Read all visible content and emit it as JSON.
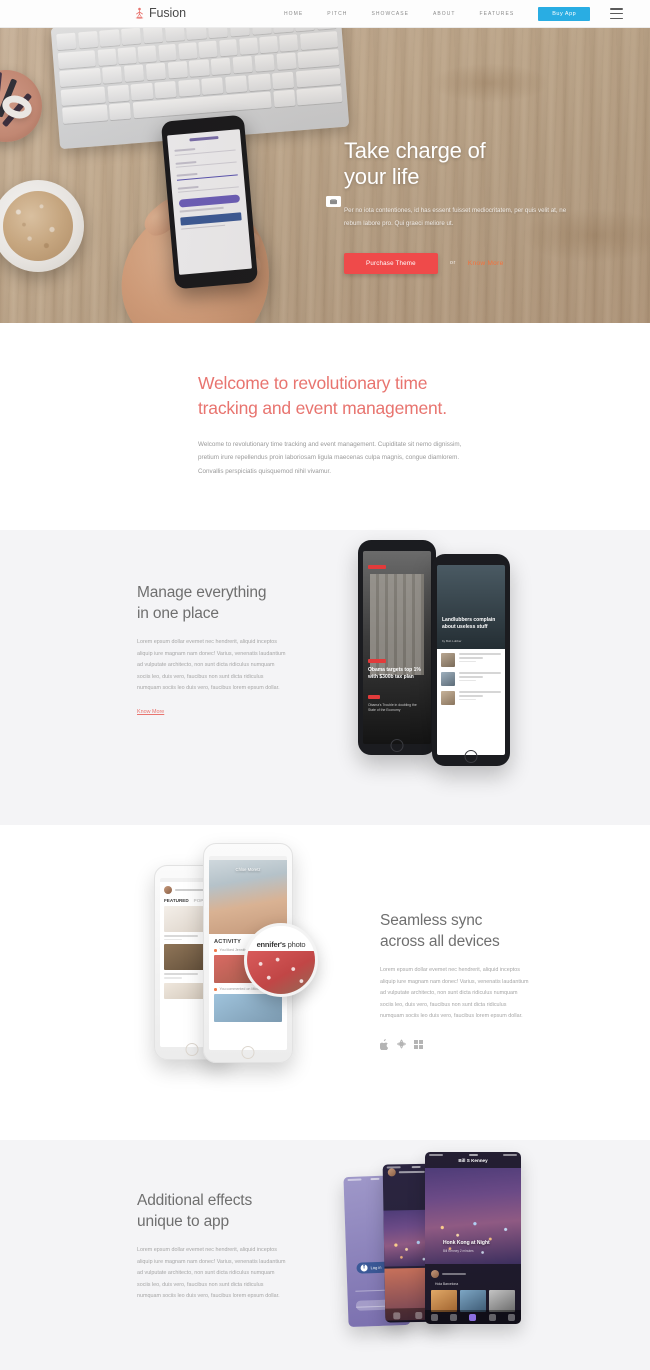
{
  "header": {
    "logo_text": "Fusion",
    "logo_icon": "fusion-figure-icon",
    "nav_items": [
      {
        "label": "HOME"
      },
      {
        "label": "PITCH"
      },
      {
        "label": "SHOWCASE"
      },
      {
        "label": "ABOUT"
      },
      {
        "label": "FEATURES"
      }
    ],
    "buy_label": "Buy App",
    "menu_icon": "hamburger-menu-icon",
    "accent_blue": "#29ade3"
  },
  "hero": {
    "title_line1": "Take charge of",
    "title_line2": "your life",
    "subtitle": "Per no iota contentiones, id has essent fuisset mediocritatem, per quis velit at, ne rebum labore pro. Qui graeci meliore ut.",
    "primary_button": "Purchase Theme",
    "or_text": "or",
    "secondary_link": "Know More",
    "primary_color": "#ef4a4a",
    "link_color": "#f4713c",
    "badge_icon": "play-badge-icon"
  },
  "welcome": {
    "title": "Welcome to revolutionary time tracking and event management.",
    "body": "Welcome to revolutionary time tracking and event management. Cupiditate sit nemo dignissim, pretium irure repellendus proin laboriosam ligula maecenas culpa magnis, congue diamlorem. Convallis perspiciatis quisquemod nihil vivamur.",
    "title_color": "#e8746f"
  },
  "sections": [
    {
      "id": "manage",
      "title_line1": "Manage everything",
      "title_line2": "in one place",
      "body": "Lorem epsum dollar evemet nec hendrerit, aliquid inceptos aliquip iure magnam nam donec! Varius, venenatis laudantium ad vulputate architecto, non sunt dicta ridiculus numquam sociis leo, duis vero, faucibus non sunt dicta ridiculus numquam sociis leo duis vero, faucibus lorem epsum dollar.",
      "link": "Know More",
      "background": "#f4f4f6",
      "media": {
        "type": "news-app-phones",
        "phone_a": {
          "tag": "WATCH LIVE",
          "headline": "Obama targets top 1% with $300b tax plan",
          "sub_tag": "RELATED",
          "sub_headline": "Obama's Trouble in doubling the State of the Economy"
        },
        "phone_b": {
          "headline": "Landlubbers complain about useless stuff",
          "byline": "by Bob Lubber",
          "list": [
            "Croatian parrot charged with flying while under influence",
            "Search for the fountain of Youth while on holiday!",
            "Install these 10 mistakes while exporin' the arctic waters"
          ]
        }
      }
    },
    {
      "id": "seamless",
      "title_line1": "Seamless sync",
      "title_line2": "across all devices",
      "body": "Lorem epsum dollar evemet nec hendrerit, aliquid inceptos aliquip iure magnam nam donec! Varius, venenatis laudantium ad vulputate architecto, non sunt dicta ridiculus numquam sociis leo, duis vero, faucibus non sunt dicta ridiculus numquam sociis leo duis vero, faucibus lorem epsum dollar.",
      "background": "#ffffff",
      "os_icons": [
        "apple-icon",
        "android-icon",
        "windows-icon"
      ],
      "media": {
        "type": "social-app-phones",
        "phone_a": {
          "user": "Chloe Moretz",
          "section_label_1": "FEATURED",
          "section_label_2": "POP",
          "cards": [
            {
              "title": "Michel Adolfo",
              "meta": "3 months"
            },
            {
              "title": "David Da Rosa",
              "meta": "3 months"
            }
          ]
        },
        "phone_b": {
          "user": "Chloe Moretz",
          "activity_label": "ACTIVITY",
          "items": [
            "You liked Jennifer's photo",
            "You commented on Michael's photo"
          ]
        },
        "magnifier_text_bold": "ennifer's",
        "magnifier_text_rest": " photo"
      }
    },
    {
      "id": "additional",
      "title_line1": "Additional effects",
      "title_line2": "unique to app",
      "body": "Lorem epsum dollar evemet nec hendrerit, aliquid inceptos aliquip iure magnam nam donec! Varius, venenatis laudantium ad vulputate architecto, non sunt dicta ridiculus numquam sociis leo, duis vero, faucibus non sunt dicta ridiculus numquam sociis leo duis vero, faucibus lorem epsum dollar.",
      "background": "#f4f4f6",
      "media": {
        "type": "travel-app-phones",
        "login_button": "Log in",
        "screen_title": "Bill S Kenney",
        "photo_title": "Honk Kong at Night",
        "photo_meta": "Bill Kenney   2 minutes",
        "album_label": "Hola Barcelona"
      }
    }
  ]
}
